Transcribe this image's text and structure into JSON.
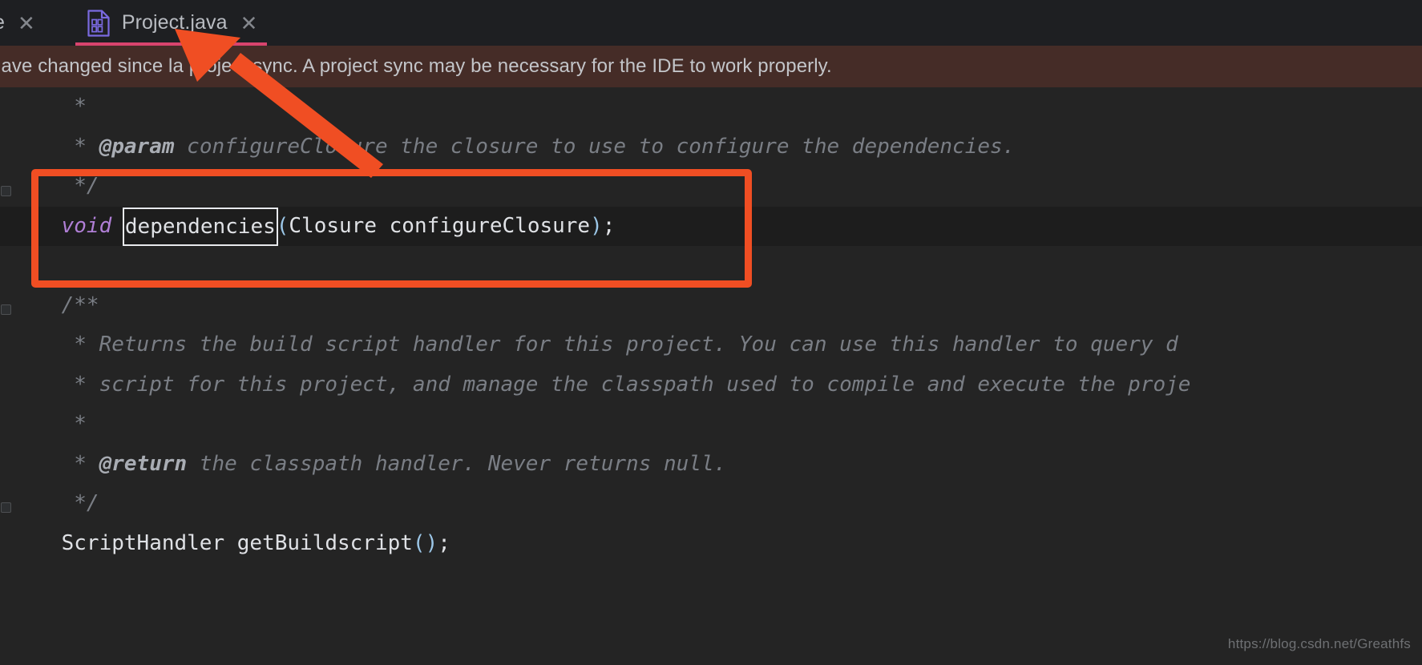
{
  "window": {
    "background_color": "#242424",
    "accent_color": "#f04e23"
  },
  "tabbar": {
    "background_color": "#1e1f22",
    "active_underline_color": "#d9446e",
    "tabs": [
      {
        "label": "e",
        "close_glyph": "✕",
        "active": false,
        "clipped": true
      },
      {
        "label": "Project.java",
        "close_glyph": "✕",
        "active": true,
        "clipped": false,
        "icon": "java-file-icon",
        "icon_digits_top": "01",
        "icon_digits_bottom": "10",
        "icon_color": "#6a5acd"
      }
    ]
  },
  "notification": {
    "background_color": "#452c27",
    "text": "have changed since la project sync. A project sync may be necessary for the IDE to work properly."
  },
  "editor": {
    "background_color": "#242424",
    "current_line_background": "#1d1d1d",
    "lines": [
      {
        "id": "line-comment-star-1",
        "current": false,
        "indent": 5,
        "tokens": [
          {
            "text": "*",
            "style": "cmt"
          }
        ]
      },
      {
        "id": "line-param-configureclosure",
        "current": false,
        "indent": 5,
        "tokens": [
          {
            "text": "* ",
            "style": "cmt"
          },
          {
            "text": "@param",
            "style": "cmt-tag"
          },
          {
            "text": " configureClosure the closure to use to configure the dependencies.",
            "style": "cmt"
          }
        ]
      },
      {
        "id": "line-comment-close-1",
        "current": false,
        "indent": 5,
        "tokens": [
          {
            "text": "*/",
            "style": "cmt"
          }
        ]
      },
      {
        "id": "line-void-dependencies",
        "current": true,
        "indent": 4,
        "tokens": [
          {
            "text": "void",
            "style": "kw"
          },
          {
            "text": " ",
            "style": "plain"
          },
          {
            "text": "dependencies",
            "style": "ident",
            "selected": true
          },
          {
            "text": "(",
            "style": "punct"
          },
          {
            "text": "Closure configureClosure",
            "style": "plain"
          },
          {
            "text": ")",
            "style": "punct"
          },
          {
            "text": ";",
            "style": "plain"
          }
        ]
      },
      {
        "id": "line-blank-1",
        "current": false,
        "indent": 0,
        "tokens": []
      },
      {
        "id": "line-javadoc-open",
        "current": false,
        "indent": 4,
        "tokens": [
          {
            "text": "/**",
            "style": "cmt"
          }
        ]
      },
      {
        "id": "line-returns-build-script",
        "current": false,
        "indent": 5,
        "tokens": [
          {
            "text": "* Returns the build script handler for this project. You can use this handler to query d",
            "style": "cmt"
          }
        ]
      },
      {
        "id": "line-script-for-project",
        "current": false,
        "indent": 5,
        "tokens": [
          {
            "text": "* script for this project, and manage the classpath used to compile and execute the proje",
            "style": "cmt"
          }
        ]
      },
      {
        "id": "line-comment-star-2",
        "current": false,
        "indent": 5,
        "tokens": [
          {
            "text": "*",
            "style": "cmt"
          }
        ]
      },
      {
        "id": "line-return-classpath",
        "current": false,
        "indent": 5,
        "tokens": [
          {
            "text": "* ",
            "style": "cmt"
          },
          {
            "text": "@return",
            "style": "cmt-tag"
          },
          {
            "text": " the classpath handler. Never returns null.",
            "style": "cmt"
          }
        ]
      },
      {
        "id": "line-comment-close-2",
        "current": false,
        "indent": 5,
        "tokens": [
          {
            "text": "*/",
            "style": "cmt"
          }
        ]
      },
      {
        "id": "line-scripthandler-getbuildscript",
        "current": false,
        "indent": 4,
        "tokens": [
          {
            "text": "ScriptHandler getBuildscript",
            "style": "plain"
          },
          {
            "text": "()",
            "style": "punct"
          },
          {
            "text": ";",
            "style": "plain"
          }
        ]
      }
    ]
  },
  "annotations": {
    "color": "#f04e23",
    "highlight_rectangle": "orange-rectangle-around-dependencies-method",
    "arrow": "orange-arrow-pointing-to-project-java-tab"
  },
  "watermark": {
    "text": "https://blog.csdn.net/Greathfs"
  }
}
